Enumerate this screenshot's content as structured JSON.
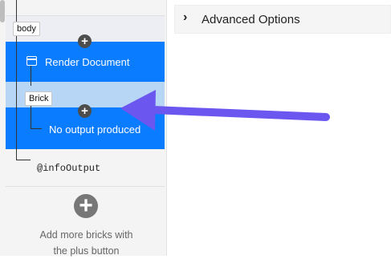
{
  "sidebar": {
    "body_tag": "body",
    "render_document_label": "Render Document",
    "brick_tag": "Brick",
    "no_output_label": "No output produced",
    "info_output_label": "@infoOutput",
    "add_more_hint_line1": "Add more bricks with",
    "add_more_hint_line2": "the plus button"
  },
  "main": {
    "advanced_options_label": "Advanced Options",
    "advanced_options_state": "collapsed"
  },
  "colors": {
    "selected_blue": "#0a7cff",
    "hover_light_blue": "#b7d6f5",
    "arrow": "#6b56f0"
  },
  "icons": [
    "plus-icon",
    "document-icon",
    "chevron-right-icon",
    "arrow-annotation"
  ]
}
